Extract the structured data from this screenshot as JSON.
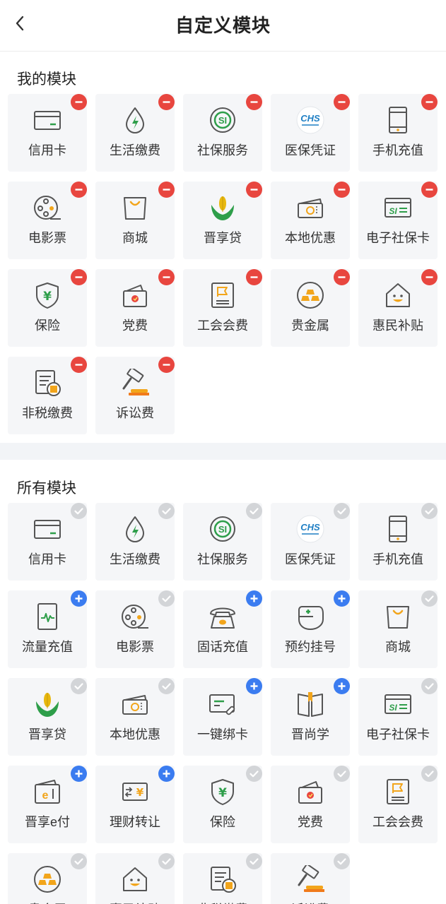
{
  "header": {
    "title": "自定义模块"
  },
  "my_section": {
    "title": "我的模块",
    "items": [
      {
        "label": "信用卡",
        "icon": "credit-card-icon"
      },
      {
        "label": "生活缴费",
        "icon": "water-drop-bolt-icon"
      },
      {
        "label": "社保服务",
        "icon": "social-security-icon"
      },
      {
        "label": "医保凭证",
        "icon": "chs-medical-insurance-logo"
      },
      {
        "label": "手机充值",
        "icon": "mobile-phone-icon"
      },
      {
        "label": "电影票",
        "icon": "film-reel-icon"
      },
      {
        "label": "商城",
        "icon": "shopping-bag-icon"
      },
      {
        "label": "晋享贷",
        "icon": "corn-wheat-logo"
      },
      {
        "label": "本地优惠",
        "icon": "coupon-ticket-icon"
      },
      {
        "label": "电子社保卡",
        "icon": "si-card-icon"
      },
      {
        "label": "保险",
        "icon": "shield-yen-icon"
      },
      {
        "label": "党费",
        "icon": "party-wallet-icon"
      },
      {
        "label": "工会会费",
        "icon": "union-flag-doc-icon"
      },
      {
        "label": "贵金属",
        "icon": "gold-bars-icon"
      },
      {
        "label": "惠民补贴",
        "icon": "smiling-house-icon"
      },
      {
        "label": "非税缴费",
        "icon": "tax-bill-icon"
      },
      {
        "label": "诉讼费",
        "icon": "gavel-icon"
      }
    ]
  },
  "all_section": {
    "title": "所有模块",
    "items": [
      {
        "label": "信用卡",
        "icon": "credit-card-icon",
        "state": "added"
      },
      {
        "label": "生活缴费",
        "icon": "water-drop-bolt-icon",
        "state": "added"
      },
      {
        "label": "社保服务",
        "icon": "social-security-icon",
        "state": "added"
      },
      {
        "label": "医保凭证",
        "icon": "chs-medical-insurance-logo",
        "state": "added"
      },
      {
        "label": "手机充值",
        "icon": "mobile-phone-icon",
        "state": "added"
      },
      {
        "label": "流量充值",
        "icon": "data-traffic-icon",
        "state": "add"
      },
      {
        "label": "电影票",
        "icon": "film-reel-icon",
        "state": "added"
      },
      {
        "label": "固话充值",
        "icon": "landline-phone-icon",
        "state": "add"
      },
      {
        "label": "预约挂号",
        "icon": "medical-appointment-icon",
        "state": "add"
      },
      {
        "label": "商城",
        "icon": "shopping-bag-icon",
        "state": "added"
      },
      {
        "label": "晋享贷",
        "icon": "corn-wheat-logo",
        "state": "added"
      },
      {
        "label": "本地优惠",
        "icon": "coupon-ticket-icon",
        "state": "added"
      },
      {
        "label": "一键绑卡",
        "icon": "bind-card-link-icon",
        "state": "add"
      },
      {
        "label": "晋尚学",
        "icon": "open-book-icon",
        "state": "add"
      },
      {
        "label": "电子社保卡",
        "icon": "si-card-icon",
        "state": "added"
      },
      {
        "label": "晋享e付",
        "icon": "e-wallet-icon",
        "state": "add"
      },
      {
        "label": "理财转让",
        "icon": "finance-transfer-icon",
        "state": "add"
      },
      {
        "label": "保险",
        "icon": "shield-yen-icon",
        "state": "added"
      },
      {
        "label": "党费",
        "icon": "party-wallet-icon",
        "state": "added"
      },
      {
        "label": "工会会费",
        "icon": "union-flag-doc-icon",
        "state": "added"
      },
      {
        "label": "贵金属",
        "icon": "gold-bars-icon",
        "state": "added"
      },
      {
        "label": "惠民补贴",
        "icon": "smiling-house-icon",
        "state": "added"
      },
      {
        "label": "非税缴费",
        "icon": "tax-bill-icon",
        "state": "added"
      },
      {
        "label": "诉讼费",
        "icon": "gavel-icon",
        "state": "added"
      }
    ]
  },
  "colors": {
    "remove_badge": "#e8463f",
    "add_badge": "#3b7cf0",
    "added_badge": "#d3d5d8",
    "icon_stroke": "#555555",
    "icon_accent": "#f2a51b",
    "icon_green": "#2e9e4a",
    "tile_bg": "#f5f6f8",
    "divider": "#f2f4f7"
  }
}
